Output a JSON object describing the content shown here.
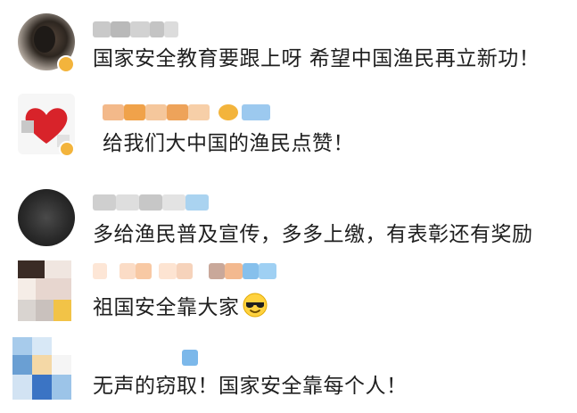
{
  "comments": [
    {
      "text": "国家安全教育要跟上呀 希望中国渔民再立新功！",
      "avatar": "dark-portrait",
      "has_emoji": false
    },
    {
      "text": "给我们大中国的渔民点赞！",
      "avatar": "red-heart",
      "has_emoji": false
    },
    {
      "text": "多给渔民普及宣传，多多上缴，有表彰还有奖励",
      "avatar": "dark-circle",
      "has_emoji": false
    },
    {
      "text": "祖国安全靠大家",
      "avatar": "cartoon",
      "has_emoji": true,
      "emoji": "sunglasses-face-icon"
    },
    {
      "text": "无声的窃取！国家安全靠每个人！",
      "avatar": "blue-pixel",
      "has_emoji": false
    }
  ],
  "colors": {
    "text": "#1f1f1f",
    "name_gray": "#bdbdbd",
    "name_orange": "#f0a24a",
    "name_blue": "#8ec4ef",
    "badge_gold": "#f3b43c"
  }
}
